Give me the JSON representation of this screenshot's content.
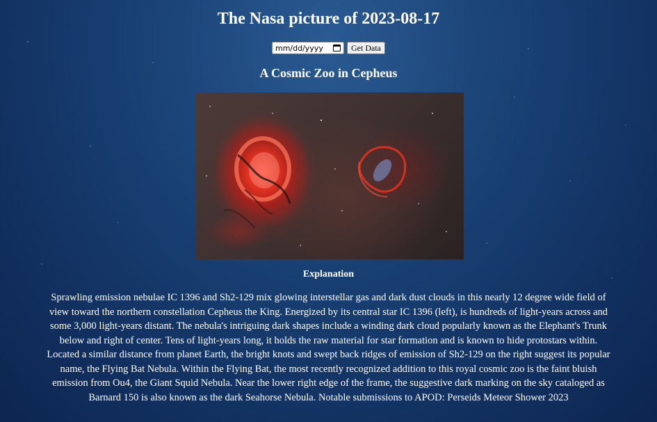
{
  "page": {
    "title": "The Nasa picture of 2023-08-17"
  },
  "controls": {
    "date_placeholder": "mm/dd/yyyy",
    "date_icon": "calendar-icon",
    "get_button_label": "Get Data"
  },
  "picture": {
    "title": "A Cosmic Zoo in Cepheus",
    "image_alt": "A Cosmic Zoo in Cepheus"
  },
  "explanation": {
    "heading": "Explanation",
    "text": "Sprawling emission nebulae IC 1396 and Sh2-129 mix glowing interstellar gas and dark dust clouds in this nearly 12 degree wide field of view toward the northern constellation Cepheus the King. Energized by its central star IC 1396 (left), is hundreds of light-years across and some 3,000 light-years distant. The nebula's intriguing dark shapes include a winding dark cloud popularly known as the Elephant's Trunk below and right of center. Tens of light-years long, it holds the raw material for star formation and is known to hide protostars within. Located a similar distance from planet Earth, the bright knots and swept back ridges of emission of Sh2-129 on the right suggest its popular name, the Flying Bat Nebula. Within the Flying Bat, the most recently recognized addition to this royal cosmic zoo is the faint bluish emission from Ou4, the Giant Squid Nebula. Near the lower right edge of the frame, the suggestive dark marking on the sky cataloged as Barnard 150 is also known as the dark Seahorse Nebula. Notable submissions to APOD: Perseids Meteor Shower 2023"
  },
  "colors": {
    "background": "#1b4478",
    "text": "#ffffff",
    "nebula_red": "#e3321f",
    "squid_blue": "#7f9fe0"
  }
}
